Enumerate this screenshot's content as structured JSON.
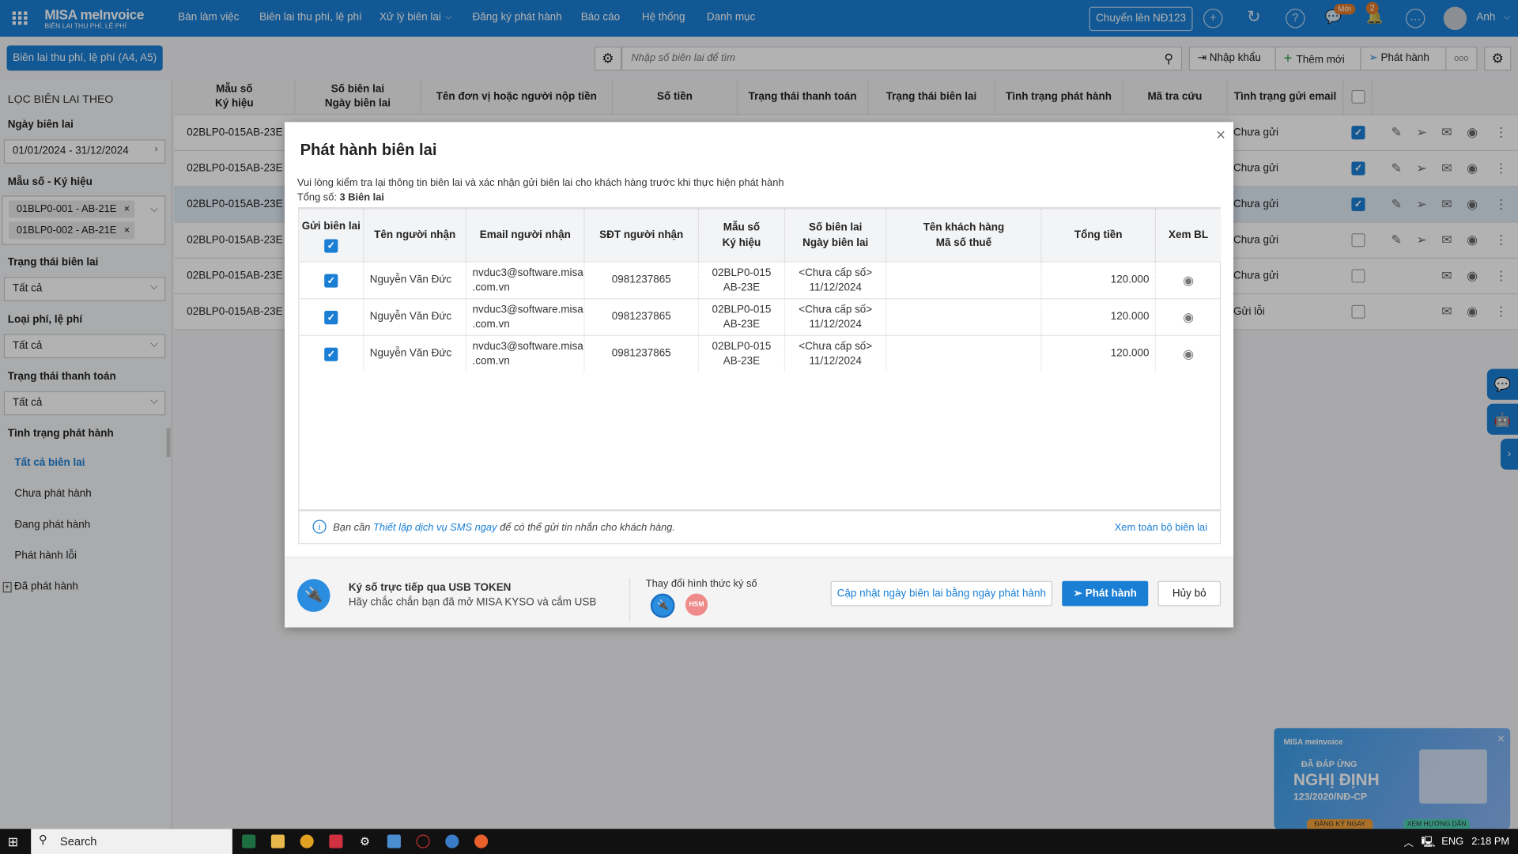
{
  "app": {
    "logo": "MISA meInvoice",
    "logo_sub": "BIÊN LAI THU PHÍ, LỆ PHÍ",
    "nav": [
      "Bàn làm việc",
      "Biên lai thu phí, lệ phí",
      "Xử lý biên lai",
      "Đăng ký phát hành",
      "Báo cáo",
      "Hệ thống",
      "Danh mục"
    ],
    "convert_button": "Chuyển lên NĐ123",
    "badge_new": "Mới",
    "notif_count": "2",
    "user": "Anh",
    "accent": "#1a7fd4"
  },
  "toolbar": {
    "doc_type_button": "Biên lai thu phí, lệ phí (A4, A5)",
    "search_placeholder": "Nhập số biên lai để tìm",
    "import": "Nhập khẩu",
    "add": "Thêm mới",
    "issue": "Phát hành",
    "more": "ooo"
  },
  "sidebar": {
    "title": "LỌC BIÊN LAI THEO",
    "date_label": "Ngày biên lai",
    "date_value": "01/01/2024 - 31/12/2024",
    "template_label": "Mẫu số - Ký hiệu",
    "template_tags": [
      "01BLP0-001 - AB-21E",
      "01BLP0-002 - AB-21E"
    ],
    "receipt_status_label": "Trạng thái biên lai",
    "receipt_status": "Tất cả",
    "fee_type_label": "Loại phí, lệ phí",
    "fee_type": "Tất cả",
    "payment_status_label": "Trạng thái thanh toán",
    "payment_status": "Tất cả",
    "issue_status_label": "Tình trạng phát hành",
    "issue_filters": [
      "Tất cả biên lai",
      "Chưa phát hành",
      "Đang phát hành",
      "Phát hành lỗi",
      "Đã phát hành"
    ]
  },
  "table": {
    "headers": [
      "Mẫu số\nKý hiệu",
      "Số biên lai\nNgày biên lai",
      "Tên đơn vị hoặc người nộp tiền",
      "Số tiền",
      "Trạng thái thanh toán",
      "Trạng thái biên lai",
      "Tình trạng phát hành",
      "Mã tra cứu",
      "Tình trạng gửi email"
    ],
    "rows": [
      {
        "template": "02BLP0-015",
        "symbol": "AB-23E",
        "email_status": "Chưa gửi",
        "checked": true
      },
      {
        "template": "02BLP0-015",
        "symbol": "AB-23E",
        "email_status": "Chưa gửi",
        "checked": true
      },
      {
        "template": "02BLP0-015",
        "symbol": "AB-23E",
        "email_status": "Chưa gửi",
        "checked": true
      },
      {
        "template": "02BLP0-015",
        "symbol": "AB-23E",
        "email_status": "Chưa gửi",
        "checked": false
      },
      {
        "template": "02BLP0-015",
        "symbol": "AB-23E",
        "email_status": "Chưa gửi",
        "checked": false
      },
      {
        "template": "02BLP0-015",
        "symbol": "AB-23E",
        "email_status": "Gửi lỗi",
        "checked": false
      }
    ]
  },
  "modal": {
    "title": "Phát hành biên lai",
    "description": "Vui lòng kiểm tra lại thông tin biên lai và xác nhận gửi biên lai cho khách hàng trước khi thực hiện phát hành",
    "total_label": "Tổng số:",
    "total_value": "3 Biên lai",
    "headers": {
      "send": "Gửi biên lai",
      "name": "Tên người nhận",
      "email": "Email người nhận",
      "phone": "SĐT người nhận",
      "template": "Mẫu số\nKý hiệu",
      "number": "Số biên lai\nNgày biên lai",
      "customer": "Tên khách hàng\nMã số thuế",
      "amount": "Tổng tiền",
      "view": "Xem BL"
    },
    "rows": [
      {
        "name": "Nguyễn Văn Đức",
        "email": "nvduc3@software.misa\n.com.vn",
        "phone": "0981237865",
        "template": "02BLP0-015\nAB-23E",
        "number": "<Chưa cấp số>\n11/12/2024",
        "customer": "",
        "amount": "120.000"
      },
      {
        "name": "Nguyễn Văn Đức",
        "email": "nvduc3@software.misa\n.com.vn",
        "phone": "0981237865",
        "template": "02BLP0-015\nAB-23E",
        "number": "<Chưa cấp số>\n11/12/2024",
        "customer": "",
        "amount": "120.000"
      },
      {
        "name": "Nguyễn Văn Đức",
        "email": "nvduc3@software.misa\n.com.vn",
        "phone": "0981237865",
        "template": "02BLP0-015\nAB-23E",
        "number": "<Chưa cấp số>\n11/12/2024",
        "customer": "",
        "amount": "120.000"
      }
    ],
    "info_pre": "Bạn cần",
    "info_link": "Thiết lập dịch vụ SMS ngay",
    "info_post": "để có thể gửi tin nhắn cho khách hàng.",
    "view_all": "Xem toàn bộ biên lai",
    "sign_title": "Ký số trực tiếp qua USB TOKEN",
    "sign_sub": "Hãy chắc chắn bạn đã mở MISA KYSO và cắm USB",
    "change_sign": "Thay đổi hình thức ký số",
    "hsm": "HSM",
    "update_date_button": "Cập nhật ngày biên lai bằng ngày phát hành",
    "issue_button": "Phát hành",
    "cancel_button": "Hủy bỏ"
  },
  "banner": {
    "line1": "ĐÃ ĐÁP ỨNG",
    "line2": "NGHỊ ĐỊNH",
    "line3": "123/2020/NĐ-CP",
    "btn1": "ĐĂNG KÝ NGAY",
    "btn2": "XEM HƯỚNG DẪN"
  },
  "taskbar": {
    "search": "Search",
    "lang": "ENG",
    "time": "2:18 PM"
  }
}
